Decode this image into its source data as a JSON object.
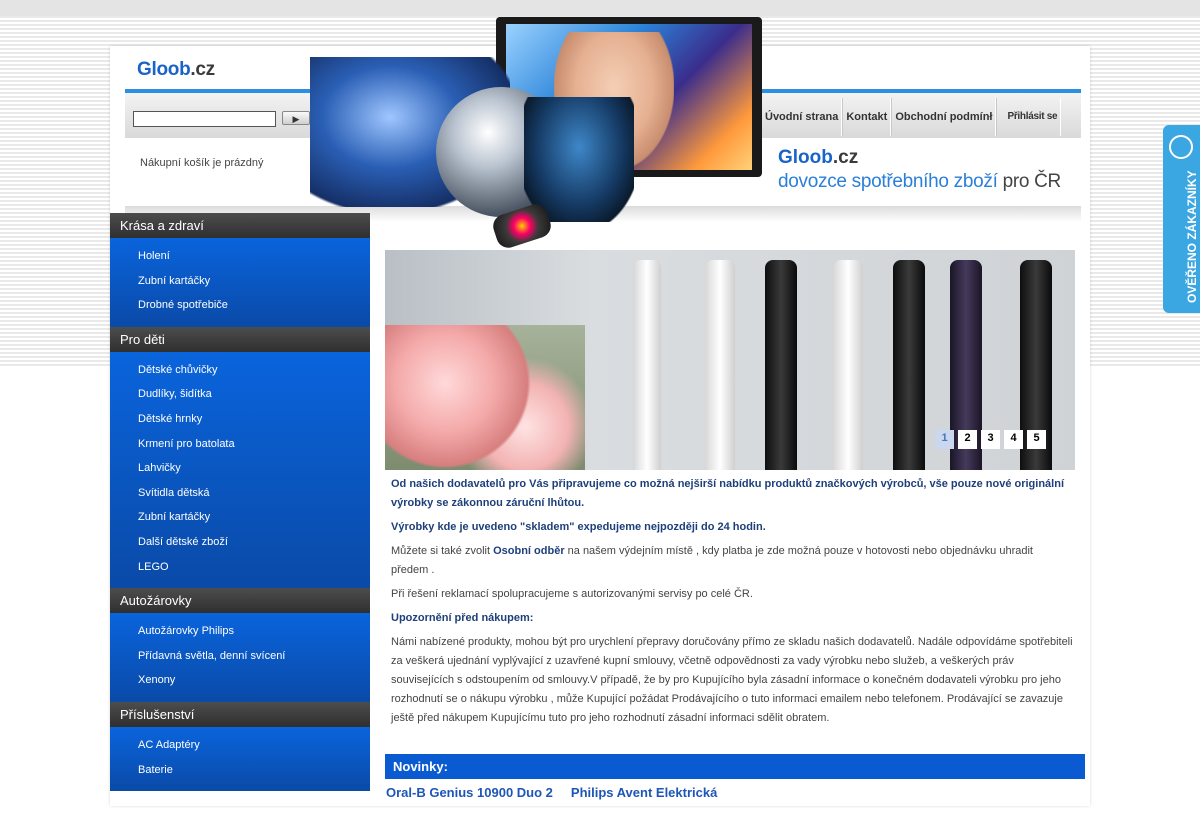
{
  "header": {
    "logo_main": "Gloob",
    "logo_tld": ".cz",
    "search": {
      "value": "",
      "button_label": "▶"
    },
    "cart_text": "Nákupní košík je prázdný",
    "nav": [
      "Úvodní strana",
      "Kontakt",
      "Obchodní podmínł",
      "Přihlásit se"
    ],
    "banner": {
      "brand_main": "Gloob",
      "brand_tld": ".cz",
      "tagline": "dovozce spotřebního zboží",
      "tagline_suffix": "pro ČR"
    }
  },
  "sidebar": {
    "categories": [
      {
        "title": "Krása a zdraví",
        "items": [
          "Holení",
          "Zubní kartáčky",
          "Drobné spotřebiče"
        ]
      },
      {
        "title": "Pro děti",
        "items": [
          "Dětské chůvičky",
          "Dudlíky, šidítka",
          "Dětské hrnky",
          "Krmení pro batolata",
          "Lahvičky",
          "Svítidla dětská",
          "Zubní kartáčky",
          "Další dětské zboží",
          "LEGO"
        ]
      },
      {
        "title": "Autožárovky",
        "items": [
          "Autožárovky Philips",
          "Přídavná světla, denní svícení",
          "Xenony"
        ]
      },
      {
        "title": "Příslušenství",
        "items": [
          "AC Adaptéry",
          "Baterie"
        ]
      }
    ]
  },
  "slider": {
    "pages": [
      "1",
      "2",
      "3",
      "4",
      "5"
    ],
    "active_page": "1"
  },
  "content": {
    "p1": "Od našich dodavatelů pro Vás připravujeme co možná nejširší nabídku produktů značkových výrobců, vše pouze nové originální výrobky se zákonnou záruční lhůtou.",
    "p2": "Výrobky kde je uvedeno \"skladem\" expedujeme nejpozději do 24 hodin.",
    "p3_a": "Můžete si také zvolit ",
    "p3_b": "Osobní odběr",
    "p3_c": " na našem výdejním místě , kdy platba je zde možná pouze v hotovosti nebo objednávku uhradit předem .",
    "p4": "Při řešení reklamací spolupracujeme s autorizovanými servisy po celé ČR.",
    "p5": "Upozornění před nákupem:",
    "p6": "Námi nabízené produkty, mohou být pro urychlení přepravy doručovány přímo ze skladu našich dodavatelů. Nadále odpovídáme spotřebiteli za veškerá ujednání vyplývající z uzavřené kupní smlouvy, včetně odpovědnosti za vady výrobku nebo služeb, a veškerých práv souvisejících s odstoupením od smlouvy.V případě, že by pro Kupujícího byla zásadní informace o konečném dodavateli výrobku pro jeho rozhodnutí se o nákupu výrobku , může Kupující požádat Prodávajícího o tuto informaci emailem nebo telefonem. Prodávající se zavazuje ještě před nákupem Kupujícímu tuto pro jeho rozhodnutí zásadní informaci sdělit obratem."
  },
  "novinky": {
    "title": "Novinky:",
    "products": [
      "Oral-B Genius 10900 Duo 2",
      "Philips Avent Elektrická"
    ]
  },
  "badge": {
    "text": "OVĚŘENO ZÁKAZNÍKY"
  },
  "colors": {
    "accent_blue": "#2d8fe0",
    "sidebar_blue": "#0a64dc",
    "sidebar_head": "#3a3a3a",
    "novinky_bar": "#0a5ad2",
    "badge": "#3aa6e2"
  }
}
